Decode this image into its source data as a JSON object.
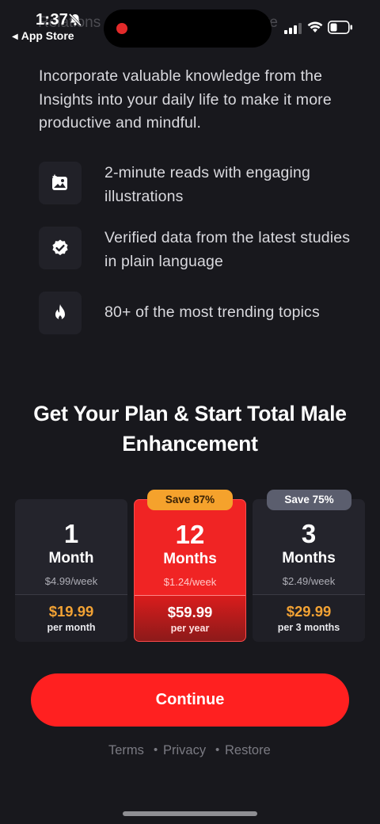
{
  "status_bar": {
    "time": "1:37",
    "back_label": "App Store",
    "behind_text_left": "Relations",
    "behind_text_right": "re"
  },
  "intro": {
    "text": "Incorporate valuable knowledge from the Insights into your daily life to make it more productive and mindful."
  },
  "features": [
    {
      "icon": "image-sparkle-icon",
      "text": "2-minute reads with engaging illustrations"
    },
    {
      "icon": "verified-badge-icon",
      "text": "Verified data from the latest studies in plain language"
    },
    {
      "icon": "flame-icon",
      "text": "80+ of the most trending topics"
    }
  ],
  "plans": {
    "title": "Get Your Plan & Start Total Male Enhancement",
    "options": [
      {
        "qty": "1",
        "unit": "Month",
        "weekly": "$4.99/week",
        "price": "$19.99",
        "period": "per month",
        "badge": "",
        "selected": false
      },
      {
        "qty": "12",
        "unit": "Months",
        "weekly": "$1.24/week",
        "price": "$59.99",
        "period": "per year",
        "badge": "Save 87%",
        "selected": true
      },
      {
        "qty": "3",
        "unit": "Months",
        "weekly": "$2.49/week",
        "price": "$29.99",
        "period": "per 3 months",
        "badge": "Save 75%",
        "selected": false
      }
    ]
  },
  "cta": {
    "label": "Continue"
  },
  "footer": {
    "terms": "Terms",
    "privacy": "Privacy",
    "restore": "Restore",
    "separator": "•"
  },
  "colors": {
    "background": "#18181d",
    "accent_red": "#ff2020",
    "price_orange": "#f2a234",
    "badge_orange": "#f5a22c",
    "badge_gray": "#5b5e6e"
  }
}
